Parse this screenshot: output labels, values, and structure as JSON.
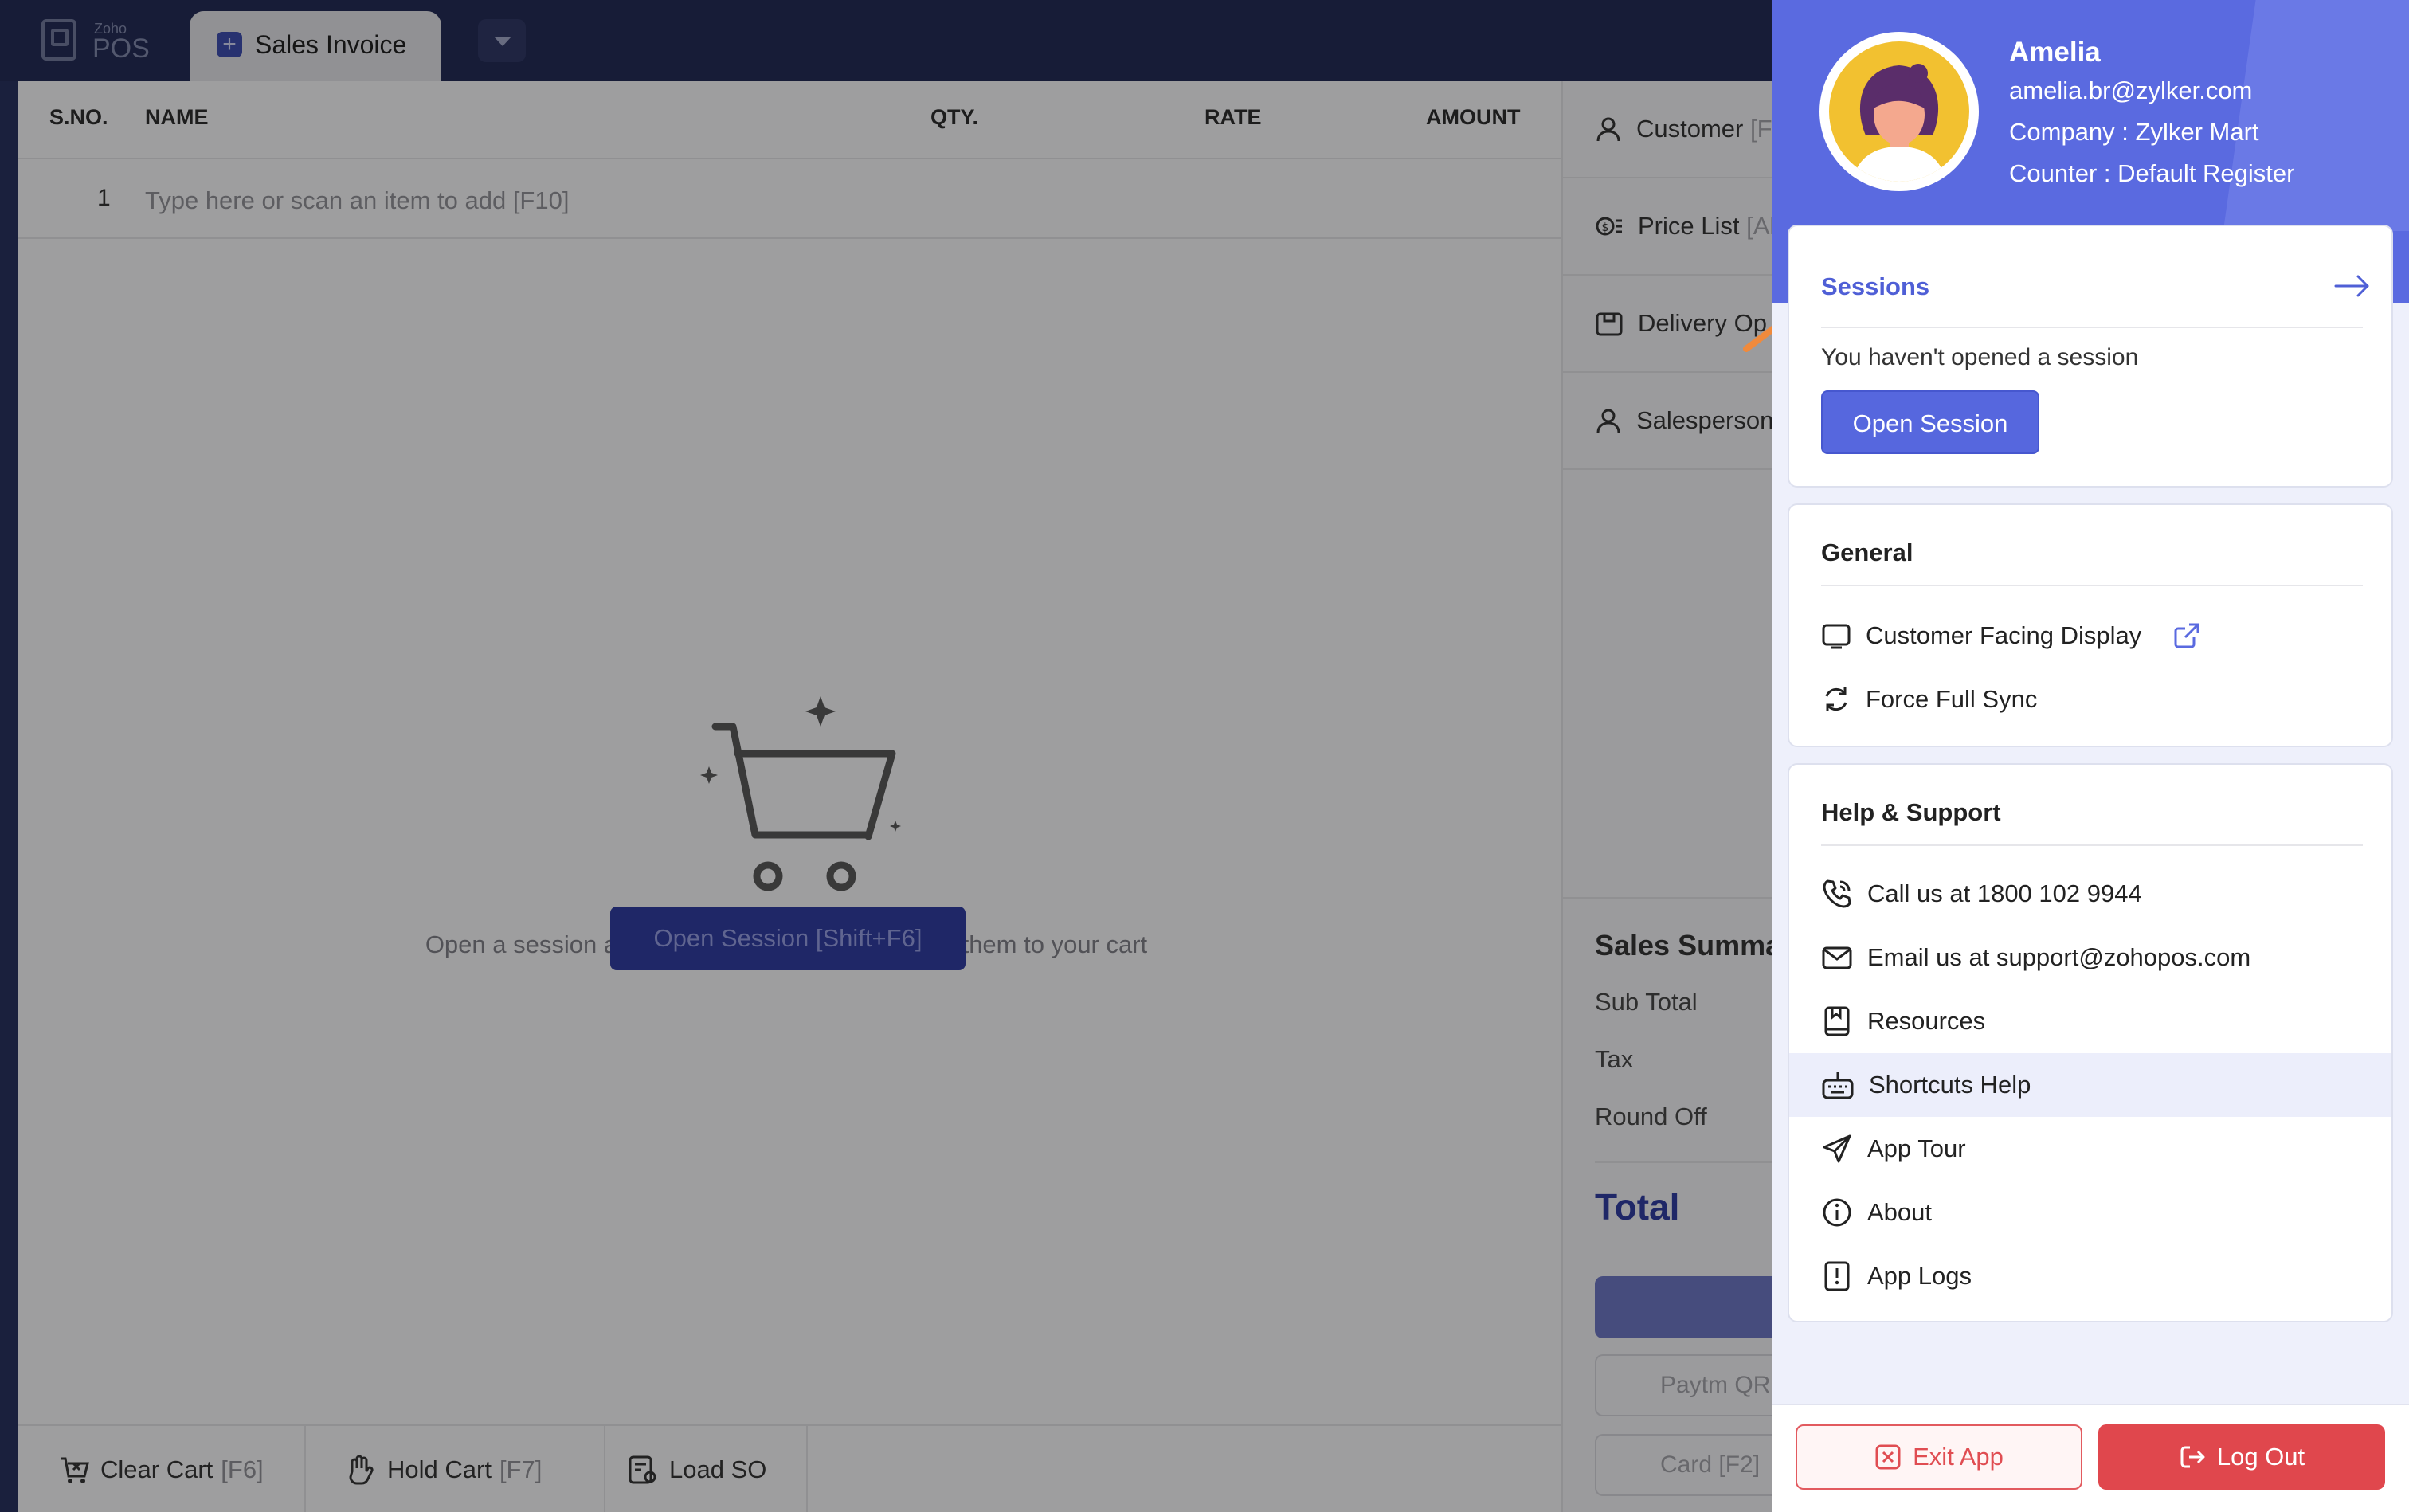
{
  "app": {
    "logo_small": "Zoho",
    "logo_big": "POS",
    "tab_label": "Sales Invoice"
  },
  "table": {
    "headers": [
      "S.NO.",
      "NAME",
      "QTY.",
      "RATE",
      "AMOUNT"
    ],
    "row_number": "1",
    "item_placeholder": "Type here or scan an item to add  [F10]"
  },
  "empty_state": {
    "message": "Open a session and search or scan items to add them to your cart",
    "button": "Open Session [Shift+F6]"
  },
  "bottom_bar": [
    {
      "label": "Clear Cart",
      "key": "[F6]"
    },
    {
      "label": "Hold Cart",
      "key": "[F7]"
    },
    {
      "label": "Load SO",
      "key": ""
    }
  ],
  "right_panel": {
    "customer": "Customer",
    "customer_suffix": "[F",
    "price_list": "Price List",
    "price_list_suffix": "[Al",
    "delivery": "Delivery Op",
    "salesperson": "Salesperson",
    "summary_title": "Sales Summa",
    "sub_total": "Sub Total",
    "tax": "Tax",
    "round_off": "Round Off",
    "total": "Total",
    "pay_paytm": "Paytm QR",
    "pay_card": "Card [F2]"
  },
  "profile": {
    "name": "Amelia",
    "email": "amelia.br@zylker.com",
    "company": "Company : Zylker Mart",
    "counter": "Counter : Default Register"
  },
  "sessions": {
    "title": "Sessions",
    "message": "You haven't opened a session",
    "button": "Open Session"
  },
  "general": {
    "title": "General",
    "items": [
      "Customer Facing Display",
      "Force Full Sync"
    ]
  },
  "help": {
    "title": "Help & Support",
    "items": [
      "Call us at 1800 102 9944",
      "Email us at support@zohopos.com",
      "Resources",
      "Shortcuts Help",
      "App Tour",
      "About",
      "App Logs"
    ]
  },
  "footer": {
    "exit": "Exit App",
    "logout": "Log Out"
  },
  "colors": {
    "accent": "#5a6ae0",
    "danger": "#e0474d",
    "pointer": "#f08a3c"
  }
}
